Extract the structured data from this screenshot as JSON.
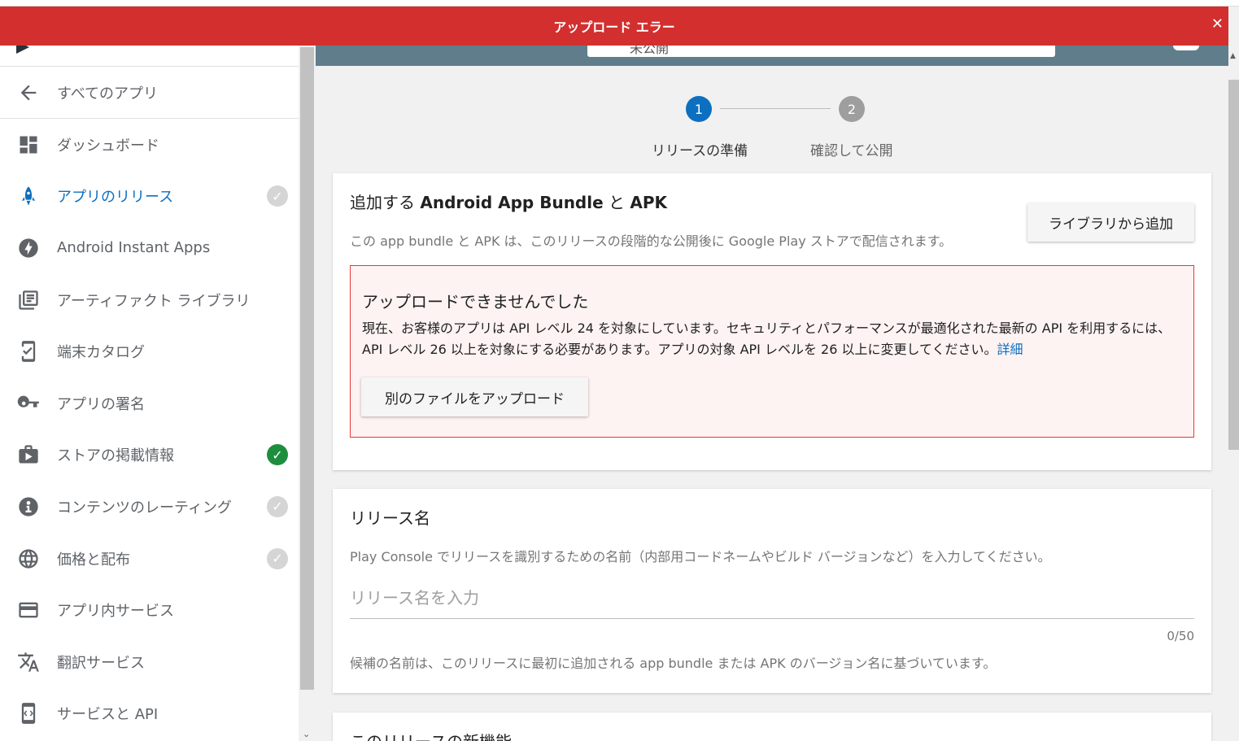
{
  "error_bar": {
    "title": "アップロード エラー",
    "close_glyph": "✕"
  },
  "header": {
    "status_text": "未公開"
  },
  "sidebar": {
    "back_label": "すべてのアプリ",
    "items": [
      {
        "label": "ダッシュボード",
        "icon": "dashboard-icon",
        "status": "none"
      },
      {
        "label": "アプリのリリース",
        "icon": "rocket-icon",
        "status": "grey-check",
        "active": true
      },
      {
        "label": "Android Instant Apps",
        "icon": "bolt-icon",
        "status": "none"
      },
      {
        "label": "アーティファクト ライブラリ",
        "icon": "library-icon",
        "status": "none"
      },
      {
        "label": "端末カタログ",
        "icon": "device-catalog-icon",
        "status": "none"
      },
      {
        "label": "アプリの署名",
        "icon": "key-icon",
        "status": "none"
      },
      {
        "label": "ストアの掲載情報",
        "icon": "store-icon",
        "status": "green-check"
      },
      {
        "label": "コンテンツのレーティング",
        "icon": "content-rating-icon",
        "status": "grey-check"
      },
      {
        "label": "価格と配布",
        "icon": "globe-icon",
        "status": "grey-check"
      },
      {
        "label": "アプリ内サービス",
        "icon": "credit-card-icon",
        "status": "none"
      },
      {
        "label": "翻訳サービス",
        "icon": "translate-icon",
        "status": "none"
      },
      {
        "label": "サービスと API",
        "icon": "api-icon",
        "status": "none"
      }
    ]
  },
  "stepper": {
    "steps": [
      {
        "number": "1",
        "label": "リリースの準備",
        "state": "active"
      },
      {
        "number": "2",
        "label": "確認して公開",
        "state": "inactive"
      }
    ]
  },
  "bundle_card": {
    "title_prefix": "追加する ",
    "title_strong": "Android App Bundle",
    "title_mid": " と ",
    "title_strong2": "APK",
    "description": "この app bundle と APK は、このリリースの段階的な公開後に Google Play ストアで配信されます。",
    "add_from_library": "ライブラリから追加",
    "error": {
      "title": "アップロードできませんでした",
      "message": "現在、お客様のアプリは API レベル 24 を対象にしています。セキュリティとパフォーマンスが最適化された最新の API を利用するには、API レベル 26 以上を対象にする必要があります。アプリの対象 API レベルを 26 以上に変更してください。",
      "link": "詳細",
      "upload_another": "別のファイルをアップロード"
    }
  },
  "release_name_card": {
    "title": "リリース名",
    "description": "Play Console でリリースを識別するための名前（内部用コードネームやビルド バージョンなど）を入力してください。",
    "input_placeholder": "リリース名を入力",
    "input_value": "",
    "counter": "0/50",
    "hint": "候補の名前は、このリリースに最初に追加される app bundle または APK のバージョン名に基づいています。"
  },
  "whats_new_card": {
    "title": "このリリースの新機能"
  },
  "colors": {
    "error_red": "#d32f2f",
    "accent_blue": "#0d6fbf",
    "success_green": "#1e8e3e",
    "header_slate": "#607d8b"
  }
}
